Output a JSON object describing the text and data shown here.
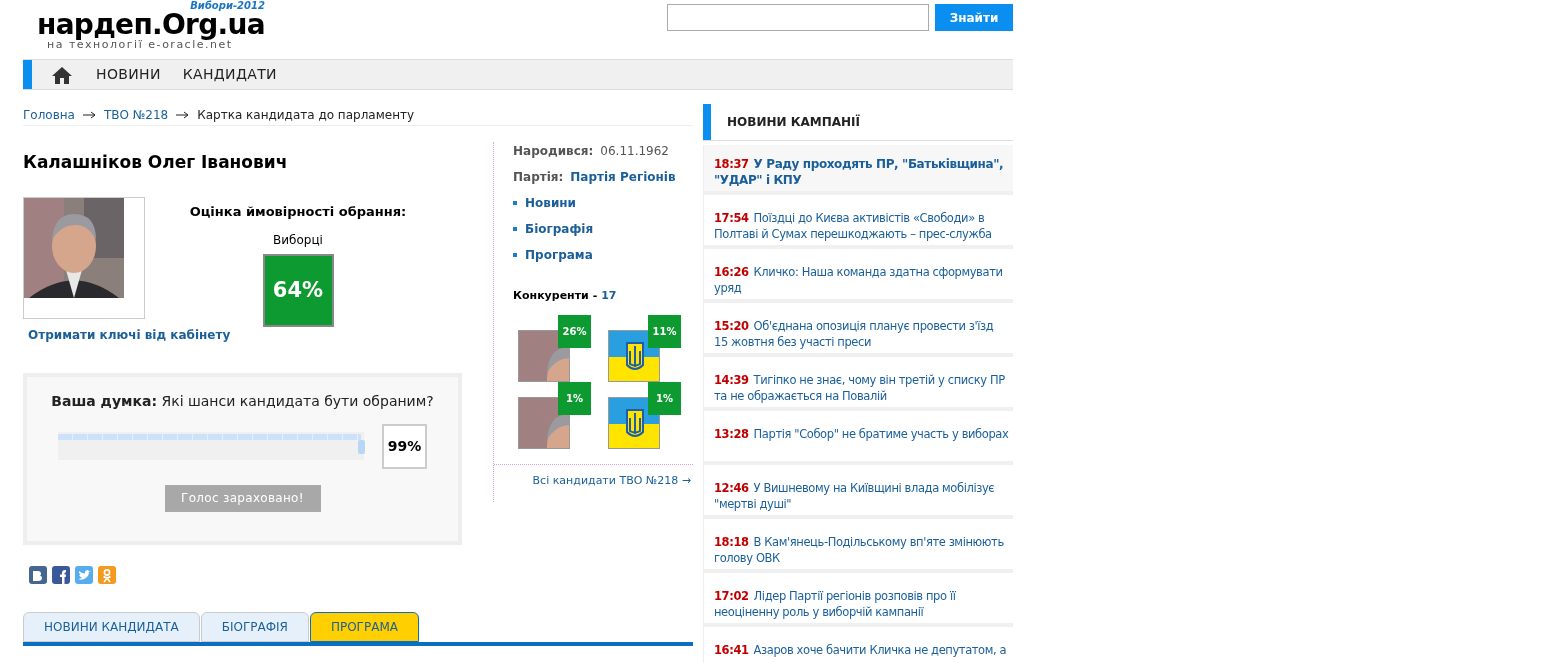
{
  "header": {
    "logo": "нардеп.Org.ua",
    "logo_badge": "Вибори-2012",
    "logo_tagline": "на технології e-oracle.net",
    "search": {
      "button": "Знайти"
    }
  },
  "nav": {
    "items": [
      "НОВИНИ",
      "КАНДИДАТИ"
    ]
  },
  "breadcrumbs": [
    {
      "label": "Головна",
      "link": true
    },
    {
      "label": "ТВО №218",
      "link": true
    },
    {
      "label": "Картка кандидата до парламенту",
      "link": false
    }
  ],
  "candidate": {
    "name": "Калашніков Олег Іванович",
    "photo": {
      "kind": "picture"
    },
    "cabinet_link": "Отримати ключі від кабінету",
    "rating": {
      "title": "Оцінка ймовірності обрання:",
      "label": "Виборці",
      "value": "64%"
    },
    "born_label": "Народився:",
    "born": "06.11.1962",
    "party_label": "Партія:",
    "party": "Партія Регіонів",
    "links": [
      "Новини",
      "Біографія",
      "Програма"
    ],
    "competitors_label": "Конкуренти -",
    "competitors_count": "17",
    "competitors": [
      {
        "kind": "person",
        "value": "26%"
      },
      {
        "kind": "flag",
        "value": "11%"
      },
      {
        "kind": "person",
        "value": "1%"
      },
      {
        "kind": "flag",
        "value": "1%"
      }
    ],
    "all_link": "Всі кандидати ТВО №218 →"
  },
  "poll": {
    "question_bold": "Ваша думка:",
    "question": "Які шанси кандидата бути обраним?",
    "level": 0.99,
    "reading": "99%",
    "button": "Голос зараховано!",
    "button_disabled": true
  },
  "tabs": [
    {
      "label": "НОВИНИ КАНДИДАТА",
      "selected": false
    },
    {
      "label": "БІОГРАФІЯ",
      "selected": false
    },
    {
      "label": "ПРОГРАМА",
      "selected": true
    }
  ],
  "news": {
    "title": "НОВИНИ КАМПАНІЇ",
    "items": [
      {
        "time": "18:37",
        "text": "У Раду проходять ПР, \"Батьківщина\", \"УДАР\" і КПУ",
        "featured": true
      },
      {
        "time": "17:54",
        "text": "Поїздці до Києва активістів «Свободи» в Полтаві й Сумах перешкоджають – прес-служба",
        "featured": false
      },
      {
        "time": "16:26",
        "text": "Кличко: Наша команда здатна сформувати уряд",
        "featured": false
      },
      {
        "time": "15:20",
        "text": "Об'єднана опозиція планує провести з'їзд 15 жовтня без участі преси",
        "featured": false
      },
      {
        "time": "14:39",
        "text": "Тигіпко не знає, чому він третій у списку ПР та не ображається на Повалій",
        "featured": false
      },
      {
        "time": "13:28",
        "text": "Партія \"Собор\" не братиме участь у виборах",
        "featured": false
      },
      {
        "time": "12:46",
        "text": "У Вишневому на Київщині влада мобілізує \"мертві душі\"",
        "featured": false
      },
      {
        "time": "18:18",
        "text": "В Кам'янець-Подільському вп'яте змінюють голову ОВК",
        "featured": false
      },
      {
        "time": "17:02",
        "text": "Лідер Партії регіонів розповів про її неоціненну роль у виборчій кампанії",
        "featured": false
      },
      {
        "time": "16:41",
        "text": "Азаров хоче бачити Кличка не депутатом, а",
        "featured": false
      }
    ]
  }
}
